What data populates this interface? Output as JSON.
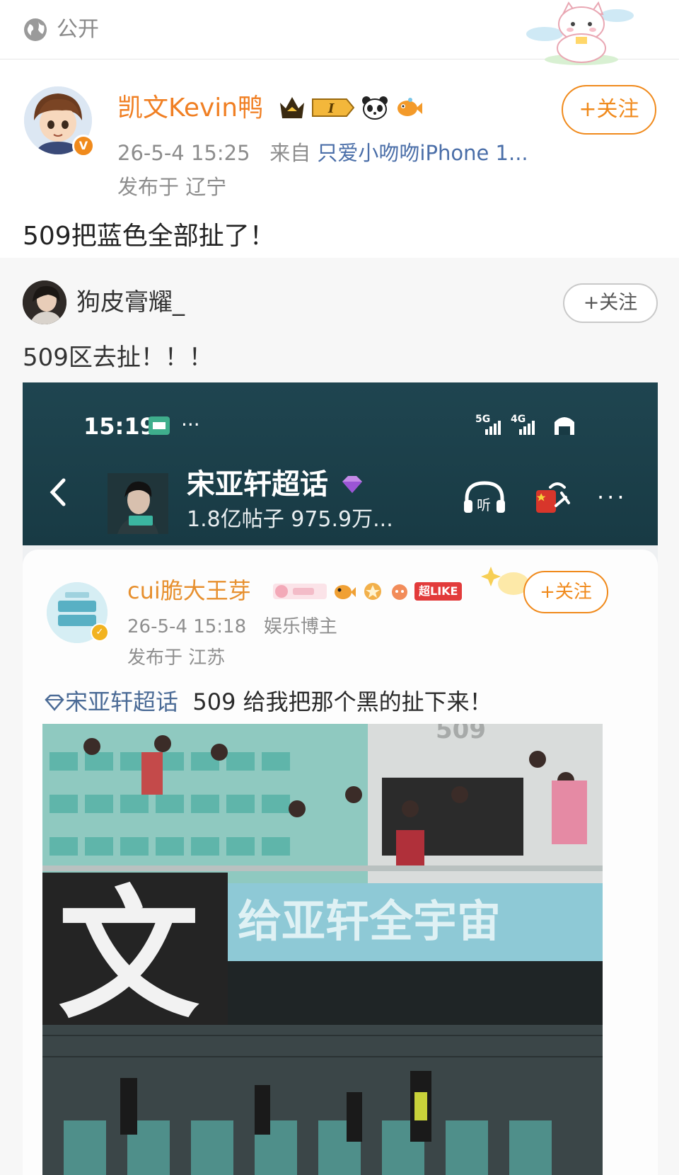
{
  "visibility": {
    "label": "公开",
    "icon": "globe-icon"
  },
  "post": {
    "author": "凯文Kevin鸭",
    "medals": [
      "crown-medal-icon",
      "level-badge-icon",
      "panda-icon",
      "fish-icon"
    ],
    "level_text": "I",
    "follow_label": "+关注",
    "time": "26-5-4 15:25",
    "source_prefix": "来自",
    "source": "只爱小吻吻iPhone 1...",
    "location": "发布于 辽宁",
    "text": "509把蓝色全部扯了！",
    "verified_badge": "V"
  },
  "repost": {
    "author": "狗皮膏耀_",
    "follow_label": "+关注",
    "text": "509区去扯！！！"
  },
  "screenshot": {
    "status_time": "15:19",
    "status_dots": "···",
    "network": "5G 4G",
    "topic_title": "宋亚轩超话",
    "topic_stats": "1.8亿帖子 975.9万...",
    "listen_label": "听",
    "more_dots": "···",
    "card": {
      "author": "cui脆大王芽",
      "like_badge": "超LIKE",
      "follow_label": "+关注",
      "time": "26-5-4 15:18",
      "role": "娱乐博主",
      "location": "发布于 江苏",
      "topic": "宋亚轩超话",
      "text": "509 给我把那个黑的扯下来！",
      "photo_banner_char": "文",
      "photo_section_label": "509",
      "photo_banner_text": "给亚轩全宇宙"
    }
  },
  "colors": {
    "author_orange": "#f07f23",
    "follow_orange": "#f08a1c",
    "meta_gray": "#8d8d8d",
    "header_teal": "#1f4550"
  }
}
